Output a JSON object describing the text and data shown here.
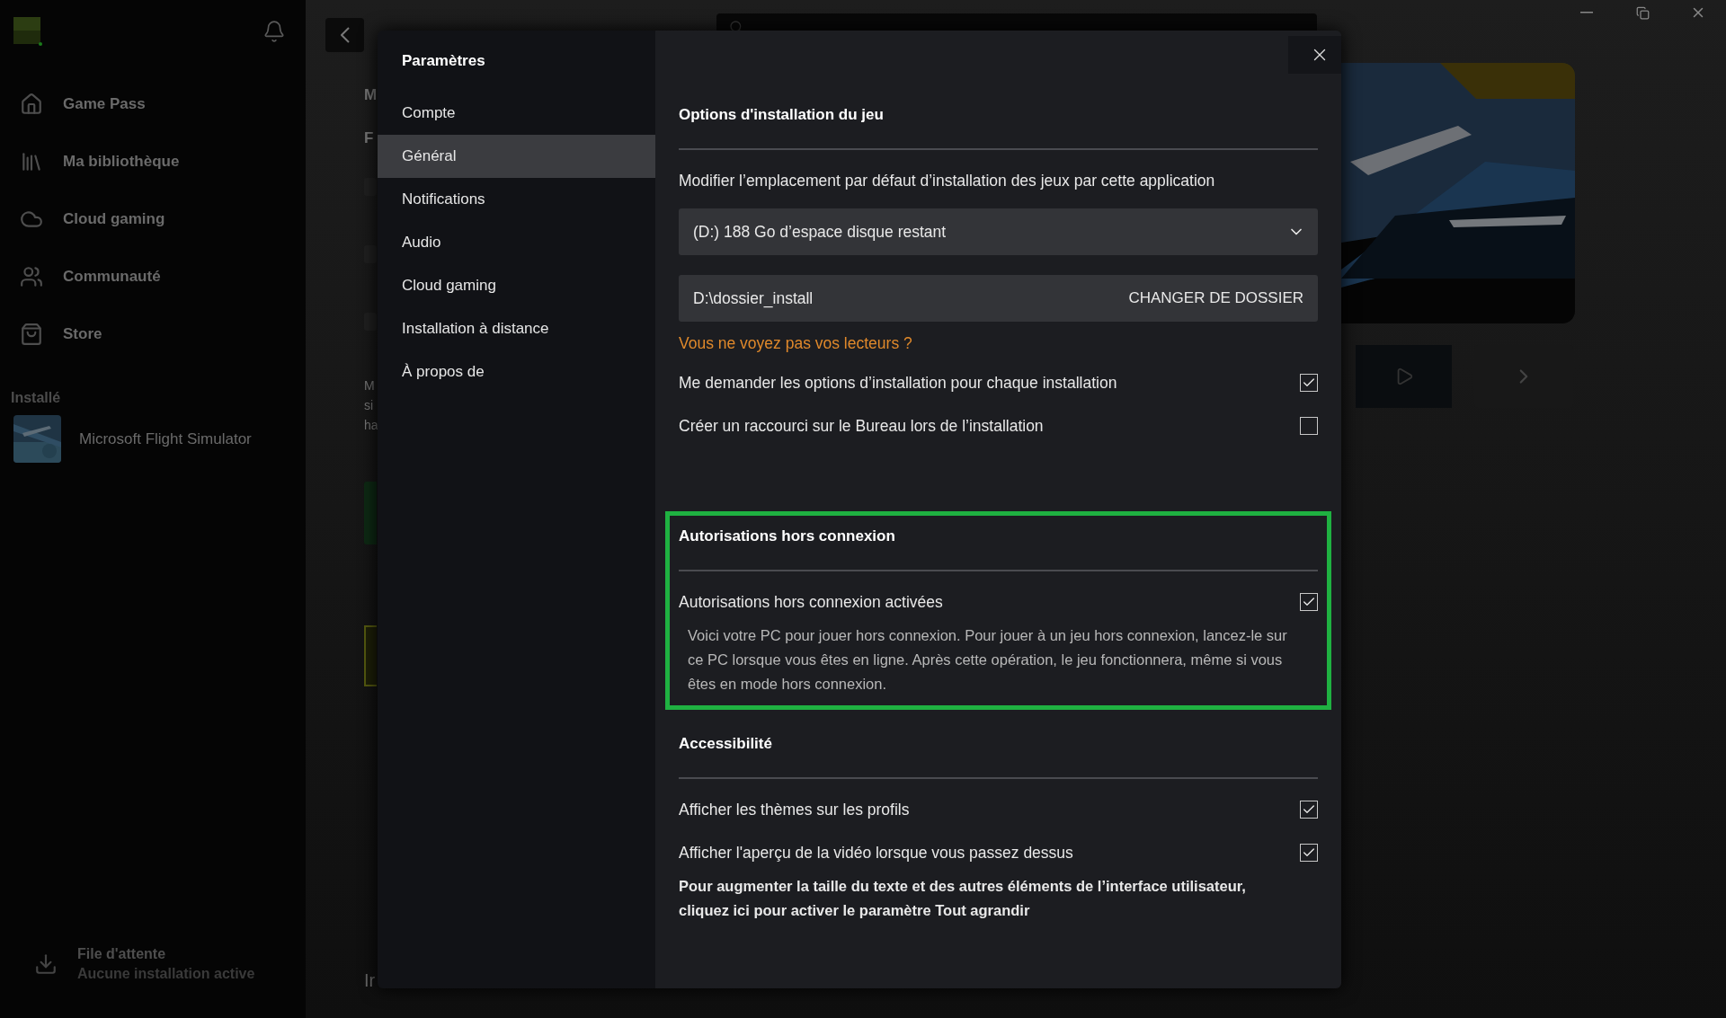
{
  "app_sidebar": {
    "nav": [
      {
        "label": "Game Pass",
        "selected": false
      },
      {
        "label": "Ma bibliothèque",
        "selected": false
      },
      {
        "label": "Cloud gaming",
        "selected": false
      },
      {
        "label": "Communauté",
        "selected": false
      },
      {
        "label": "Store",
        "selected": false
      }
    ],
    "installed_heading": "Installé",
    "installed": [
      {
        "title": "Microsoft Flight Simulator"
      }
    ],
    "queue": {
      "title": "File d'attente",
      "status": "Aucune installation active"
    }
  },
  "background_page": {
    "title_fragments": [
      "M",
      "F"
    ],
    "description_fragments": [
      "M",
      "si",
      "ha"
    ],
    "heading_fragment": "Ir"
  },
  "settings_dialog": {
    "title": "Paramètres",
    "categories": [
      {
        "label": "Compte",
        "selected": false
      },
      {
        "label": "Général",
        "selected": true
      },
      {
        "label": "Notifications",
        "selected": false
      },
      {
        "label": "Audio",
        "selected": false
      },
      {
        "label": "Cloud gaming",
        "selected": false
      },
      {
        "label": "Installation à distance",
        "selected": false
      },
      {
        "label": "À propos de",
        "selected": false
      }
    ],
    "sections": [
      {
        "title": "Options d'installation du jeu",
        "highlighted": false,
        "items": [
          {
            "kind": "label",
            "text": "Modifier l’emplacement par défaut d’installation des jeux par cette application"
          },
          {
            "kind": "dropdown",
            "value": "(D:) 188 Go d’espace disque restant"
          },
          {
            "kind": "folder",
            "value": "D:\\dossier_install",
            "button": "CHANGER DE DOSSIER"
          },
          {
            "kind": "link",
            "text": "Vous ne voyez pas vos lecteurs ?"
          },
          {
            "kind": "checkbox",
            "label": "Me demander les options d’installation pour chaque installation",
            "checked": true
          },
          {
            "kind": "checkbox",
            "label": "Créer un raccourci sur le Bureau lors de l’installation",
            "checked": false
          }
        ]
      },
      {
        "title": "Autorisations hors connexion",
        "highlighted": true,
        "items": [
          {
            "kind": "checkbox",
            "label": "Autorisations hors connexion activées",
            "checked": true
          },
          {
            "kind": "description",
            "text": "Voici votre PC pour jouer hors connexion. Pour jouer à un jeu hors connexion, lancez-le sur ce PC lorsque vous êtes en ligne. Après cette opération, le jeu fonctionnera, même si vous êtes en mode hors connexion."
          }
        ]
      },
      {
        "title": "Accessibilité",
        "highlighted": false,
        "items": [
          {
            "kind": "checkbox",
            "label": "Afficher les thèmes sur les profils",
            "checked": true
          },
          {
            "kind": "checkbox",
            "label": "Afficher l'aperçu de la vidéo lorsque vous passez dessus",
            "checked": true
          },
          {
            "kind": "note",
            "text": "Pour augmenter la taille du texte et des autres éléments de l’interface utilisateur, cliquez ici pour activer le paramètre Tout agrandir"
          }
        ]
      }
    ]
  }
}
